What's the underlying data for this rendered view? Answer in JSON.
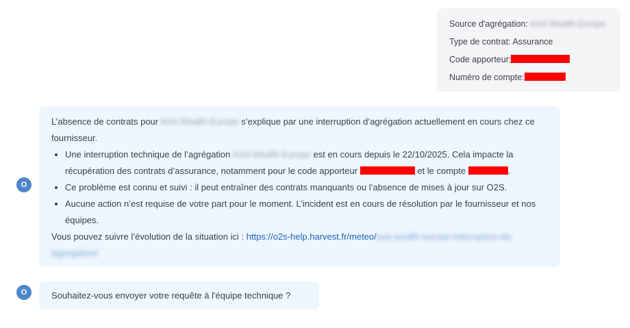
{
  "user_message": {
    "source_label": "Source d'agrégation:",
    "source_value": "AXA Wealth Europe",
    "contract_type_label": "Type de contrat:",
    "contract_type_value": "Assurance",
    "code_label": "Code apporteur:",
    "account_label": "Numéro de compte:"
  },
  "assistant": {
    "avatar_letter": "O",
    "intro_before": "L’absence de contrats pour ",
    "intro_provider": "AXA Wealth Europe",
    "intro_after": " s’explique par une interruption d’agrégation actuellement en cours chez ce fournisseur.",
    "bullet1_before": "Une interruption technique de l’agrégation ",
    "bullet1_provider": "AXA Wealth Europe",
    "bullet1_middle": " est en cours depuis le 22/10/2025. Cela impacte la récupération des contrats d’assurance, notamment pour le code apporteur ",
    "bullet1_and": " et le compte ",
    "bullet1_end": ".",
    "bullet2": "Ce problème est connu et suivi : il peut entraîner des contrats manquants ou l’absence de mises à jour sur O2S.",
    "bullet3": "Aucune action n’est requise de votre part pour le moment. L’incident est en cours de résolution par le fournisseur et nos équipes.",
    "follow_text": "Vous pouvez suivre l’évolution de la situation ici : ",
    "follow_link": "https://o2s-help.harvest.fr/meteo/",
    "follow_link_blurred": "axa-wealth-europe-interruption-de-lagregation/"
  },
  "question": {
    "avatar_letter": "O",
    "text": "Souhaitez-vous envoyer votre requête à l'équipe technique ?"
  },
  "colors": {
    "user_bubble_bg": "#f4f5f7",
    "assistant_bubble_bg": "#eef6fe",
    "avatar_bg": "#4d86c9",
    "link": "#1c63b7",
    "redaction": "#ff0000"
  }
}
